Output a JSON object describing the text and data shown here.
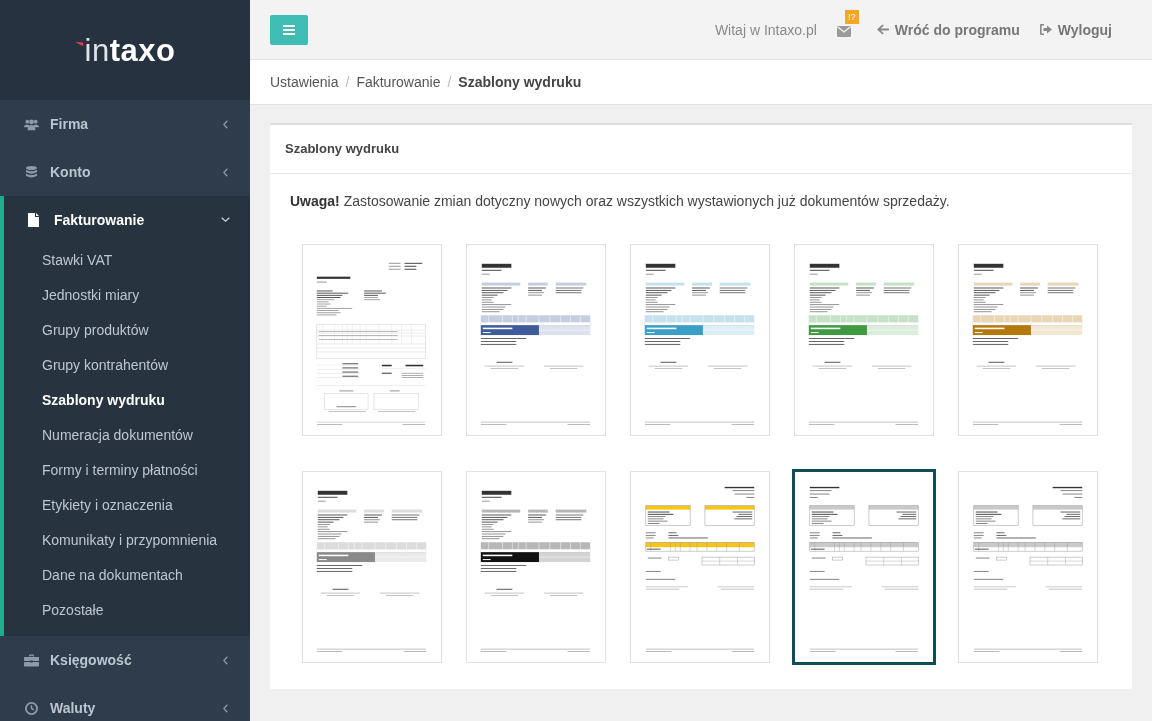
{
  "sidebar": {
    "logo": "in**taxo**",
    "items": [
      {
        "label": "Firma",
        "expanded": false
      },
      {
        "label": "Konto",
        "expanded": false
      },
      {
        "label": "Fakturowanie",
        "expanded": true,
        "children": [
          {
            "label": "Stawki VAT",
            "selected": false
          },
          {
            "label": "Jednostki miary",
            "selected": false
          },
          {
            "label": "Grupy produktów",
            "selected": false
          },
          {
            "label": "Grupy kontrahentów",
            "selected": false
          },
          {
            "label": "Szablony wydruku",
            "selected": true
          },
          {
            "label": "Numeracja dokumentów",
            "selected": false
          },
          {
            "label": "Formy i terminy płatności",
            "selected": false
          },
          {
            "label": "Etykiety i oznaczenia",
            "selected": false
          },
          {
            "label": "Komunikaty i przypomnienia",
            "selected": false
          },
          {
            "label": "Dane na dokumentach",
            "selected": false
          },
          {
            "label": "Pozostałe",
            "selected": false
          }
        ]
      },
      {
        "label": "Księgowość",
        "expanded": false
      },
      {
        "label": "Waluty",
        "expanded": false
      }
    ]
  },
  "topbar": {
    "greeting": "Witaj w Intaxo.pl",
    "badge": "!?",
    "links": [
      {
        "label": "Wróć do programu"
      },
      {
        "label": "Wyloguj"
      }
    ]
  },
  "breadcrumb": {
    "separator": "/",
    "items": [
      {
        "label": "Ustawienia",
        "current": false
      },
      {
        "label": "Fakturowanie",
        "current": false
      },
      {
        "label": "Szablony wydruku",
        "current": true
      }
    ]
  },
  "panel": {
    "title": "Szablony wydruku",
    "notice": "**Uwaga!** Zastosowanie zmian dotyczny nowych oraz wszystkich wystawionych już dokumentów sprzedaży.",
    "templates": [
      {
        "kind": "classic",
        "selected": false
      },
      {
        "kind": "modern",
        "color": "#3f5b9c",
        "selected": false
      },
      {
        "kind": "modern",
        "color": "#3a9fc6",
        "selected": false
      },
      {
        "kind": "modern",
        "color": "#3f9a42",
        "selected": false
      },
      {
        "kind": "modern",
        "color": "#b5780a",
        "selected": false
      },
      {
        "kind": "modern",
        "color": "#8a8a8a",
        "selected": false
      },
      {
        "kind": "modern",
        "color": "#111111",
        "selected": false
      },
      {
        "kind": "boxed",
        "color": "#f5c518",
        "title_left": false,
        "selected": false
      },
      {
        "kind": "boxed",
        "color": "#c9c9c9",
        "title_left": true,
        "selected": true
      },
      {
        "kind": "boxed",
        "color": "#c9c9c9",
        "title_left": false,
        "selected": false
      }
    ]
  }
}
